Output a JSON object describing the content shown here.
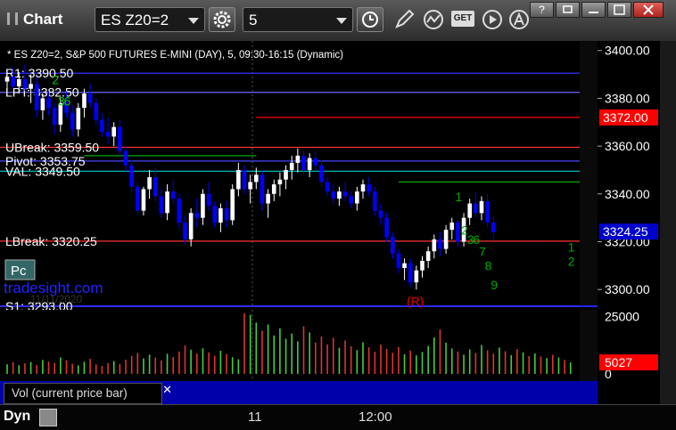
{
  "toolbar": {
    "app_title": "Chart",
    "symbol": "ES Z20=2",
    "interval": "5",
    "get_label": "GET",
    "window_help": "?"
  },
  "chart_info": "* ES Z20=2, S&P 500 FUTURES E-MINI (DAY), 5, 09:30-16:15 (Dynamic)",
  "watermark": "tradesight.com",
  "watermark_date": "11/11/2020",
  "pc_badge": "Pc",
  "r_marker": "(R)",
  "vol_label": "Vol (current price bar)",
  "dyn_label": "Dyn",
  "colors": {
    "up": "#ffffff",
    "down": "#0000ff",
    "resistance": "#ff0000",
    "support_green": "#00bb00",
    "pivot_blue": "#3333ff",
    "price_tag": "#ff0000",
    "background": "#000000"
  },
  "chart_data": [
    {
      "type": "candlestick",
      "title": "",
      "ylim": [
        3293,
        3404
      ],
      "y_ticks": [
        "3400.00",
        "3380.00",
        "3360.00",
        "3340.00",
        "3320.00",
        "3300.00"
      ],
      "x_ticks": [
        "11",
        "12:00"
      ],
      "last_price": "3324.25",
      "alert_price": "3372.00",
      "levels": [
        {
          "label": "R1: 3390.50",
          "value": 3390.5,
          "color": "#3333ff",
          "labeled": true
        },
        {
          "label": "LPT: 3382.50",
          "value": 3382.5,
          "color": "#6666ff",
          "labeled": true
        },
        {
          "label": "UBreak: 3359.50",
          "value": 3359.5,
          "color": "#ff3333",
          "labeled": true
        },
        {
          "label": "Pivot: 3353.75",
          "value": 3353.75,
          "color": "#4444ff",
          "labeled": true
        },
        {
          "label": "VAL: 3349.50",
          "value": 3349.5,
          "color": "#00cccc",
          "labeled": true
        },
        {
          "label": "LBreak: 3320.25",
          "value": 3320.25,
          "color": "#ff3333",
          "labeled": true
        },
        {
          "label": "S1: 3293.00",
          "value": 3293,
          "color": "#3333ff",
          "labeled": true
        },
        {
          "label": "",
          "value": 3372,
          "color": "#ff0000",
          "labeled": false,
          "from": 42
        },
        {
          "label": "",
          "value": 3356,
          "color": "#00aa00",
          "labeled": false,
          "from": 13,
          "to": 42
        },
        {
          "label": "",
          "value": 3345,
          "color": "#00aa00",
          "labeled": false,
          "from": 66
        }
      ],
      "ohlc": [
        [
          3387,
          3392,
          3383,
          3389
        ],
        [
          3389,
          3393,
          3384,
          3385
        ],
        [
          3385,
          3391,
          3382,
          3388
        ],
        [
          3388,
          3394,
          3383,
          3384
        ],
        [
          3384,
          3390,
          3378,
          3386
        ],
        [
          3386,
          3389,
          3372,
          3375
        ],
        [
          3375,
          3382,
          3371,
          3380
        ],
        [
          3380,
          3383,
          3373,
          3376
        ],
        [
          3376,
          3378,
          3365,
          3369
        ],
        [
          3369,
          3380,
          3366,
          3378
        ],
        [
          3378,
          3383,
          3372,
          3374
        ],
        [
          3374,
          3377,
          3364,
          3367
        ],
        [
          3367,
          3378,
          3364,
          3376
        ],
        [
          3376,
          3384,
          3372,
          3382
        ],
        [
          3382,
          3386,
          3376,
          3378
        ],
        [
          3378,
          3380,
          3369,
          3371
        ],
        [
          3371,
          3374,
          3364,
          3366
        ],
        [
          3366,
          3372,
          3361,
          3364
        ],
        [
          3364,
          3370,
          3360,
          3368
        ],
        [
          3368,
          3371,
          3356,
          3358
        ],
        [
          3358,
          3360,
          3349,
          3352
        ],
        [
          3352,
          3354,
          3341,
          3343
        ],
        [
          3343,
          3345,
          3331,
          3333
        ],
        [
          3333,
          3343,
          3331,
          3342
        ],
        [
          3342,
          3350,
          3338,
          3347
        ],
        [
          3347,
          3351,
          3337,
          3339
        ],
        [
          3339,
          3342,
          3330,
          3332
        ],
        [
          3332,
          3344,
          3329,
          3341
        ],
        [
          3341,
          3346,
          3336,
          3338
        ],
        [
          3338,
          3340,
          3326,
          3328
        ],
        [
          3328,
          3331,
          3319,
          3321
        ],
        [
          3321,
          3334,
          3318,
          3332
        ],
        [
          3332,
          3338,
          3326,
          3330
        ],
        [
          3330,
          3342,
          3327,
          3340
        ],
        [
          3340,
          3345,
          3333,
          3335
        ],
        [
          3335,
          3337,
          3326,
          3328
        ],
        [
          3328,
          3336,
          3324,
          3334
        ],
        [
          3334,
          3337,
          3326,
          3329
        ],
        [
          3329,
          3344,
          3327,
          3342
        ],
        [
          3342,
          3353,
          3339,
          3350
        ],
        [
          3350,
          3352,
          3340,
          3342
        ],
        [
          3342,
          3348,
          3336,
          3345
        ],
        [
          3345,
          3351,
          3342,
          3348
        ],
        [
          3348,
          3350,
          3333,
          3336
        ],
        [
          3336,
          3342,
          3330,
          3340
        ],
        [
          3340,
          3346,
          3337,
          3344
        ],
        [
          3344,
          3349,
          3339,
          3346
        ],
        [
          3346,
          3352,
          3342,
          3350
        ],
        [
          3350,
          3356,
          3346,
          3353
        ],
        [
          3353,
          3359,
          3349,
          3356
        ],
        [
          3356,
          3358,
          3348,
          3350
        ],
        [
          3350,
          3357,
          3347,
          3355
        ],
        [
          3355,
          3358,
          3350,
          3352
        ],
        [
          3352,
          3354,
          3343,
          3345
        ],
        [
          3345,
          3347,
          3339,
          3341
        ],
        [
          3341,
          3344,
          3336,
          3338
        ],
        [
          3338,
          3343,
          3335,
          3341
        ],
        [
          3341,
          3345,
          3337,
          3339
        ],
        [
          3339,
          3341,
          3334,
          3336
        ],
        [
          3336,
          3343,
          3333,
          3341
        ],
        [
          3341,
          3346,
          3338,
          3344
        ],
        [
          3344,
          3347,
          3339,
          3341
        ],
        [
          3341,
          3343,
          3331,
          3333
        ],
        [
          3333,
          3336,
          3327,
          3330
        ],
        [
          3330,
          3332,
          3320,
          3322
        ],
        [
          3322,
          3324,
          3313,
          3315
        ],
        [
          3315,
          3317,
          3307,
          3309
        ],
        [
          3309,
          3313,
          3304,
          3311
        ],
        [
          3311,
          3313,
          3301,
          3303
        ],
        [
          3303,
          3310,
          3300,
          3308
        ],
        [
          3308,
          3314,
          3305,
          3312
        ],
        [
          3312,
          3318,
          3309,
          3316
        ],
        [
          3316,
          3323,
          3313,
          3321
        ],
        [
          3321,
          3324,
          3314,
          3317
        ],
        [
          3317,
          3327,
          3315,
          3325
        ],
        [
          3325,
          3330,
          3321,
          3328
        ],
        [
          3328,
          3329,
          3318,
          3320
        ],
        [
          3320,
          3332,
          3318,
          3330
        ],
        [
          3330,
          3338,
          3327,
          3336
        ],
        [
          3336,
          3341,
          3330,
          3332
        ],
        [
          3332,
          3339,
          3329,
          3337
        ],
        [
          3337,
          3340,
          3326,
          3328
        ],
        [
          3328,
          3331,
          3321,
          3324
        ]
      ],
      "counts": [
        {
          "bar": 8,
          "value": 3386,
          "text": "2",
          "color": "#00cc00"
        },
        {
          "bar": 9,
          "value": 3377,
          "text": "3",
          "color": "#00cc00"
        },
        {
          "bar": 10,
          "value": 3377,
          "text": "6",
          "color": "#00cc00"
        },
        {
          "bar": 76,
          "value": 3337,
          "text": "1",
          "color": "#00aa00"
        },
        {
          "bar": 77,
          "value": 3323,
          "text": "2",
          "color": "#00aa00"
        },
        {
          "bar": 78,
          "value": 3319,
          "text": "3",
          "color": "#00aa00"
        },
        {
          "bar": 79,
          "value": 3319,
          "text": "6",
          "color": "#00aa00"
        },
        {
          "bar": 80,
          "value": 3314,
          "text": "7",
          "color": "#00aa00"
        },
        {
          "bar": 81,
          "value": 3308,
          "text": "8",
          "color": "#00aa00"
        },
        {
          "bar": 82,
          "value": 3300,
          "text": "9",
          "color": "#00aa00"
        },
        {
          "bar": 95,
          "value": 3316,
          "text": "1",
          "color": "#00aa00"
        },
        {
          "bar": 95,
          "value": 3310,
          "text": "2",
          "color": "#00aa00"
        }
      ]
    },
    {
      "type": "bar",
      "title": "Vol (current price bar)",
      "ylim": [
        0,
        28000
      ],
      "y_ticks": [
        "25000",
        "0"
      ],
      "last_value": "5027",
      "values": [
        4200,
        5100,
        3800,
        4600,
        5200,
        3900,
        6100,
        5400,
        4800,
        7200,
        5900,
        4400,
        3700,
        5300,
        6600,
        4100,
        3500,
        4700,
        5600,
        4300,
        6200,
        7800,
        9100,
        6800,
        8400,
        7100,
        5900,
        8800,
        7400,
        9800,
        12400,
        10600,
        8900,
        11200,
        9400,
        7900,
        10100,
        8700,
        7300,
        6400,
        26500,
        25800,
        22400,
        18900,
        21600,
        16800,
        19900,
        15400,
        17600,
        14200,
        20800,
        18100,
        13700,
        16300,
        12900,
        15800,
        11400,
        14600,
        12100,
        10400,
        13800,
        11600,
        9700,
        12800,
        10900,
        9200,
        11700,
        8600,
        10200,
        8100,
        9600,
        12200,
        15900,
        19400,
        13600,
        11100,
        9800,
        8400,
        10700,
        9100,
        12600,
        10300,
        8800,
        11500,
        9900,
        8200,
        10800,
        9400,
        7800,
        8900,
        7600,
        6900,
        8300,
        7200,
        6100,
        5027
      ]
    }
  ]
}
